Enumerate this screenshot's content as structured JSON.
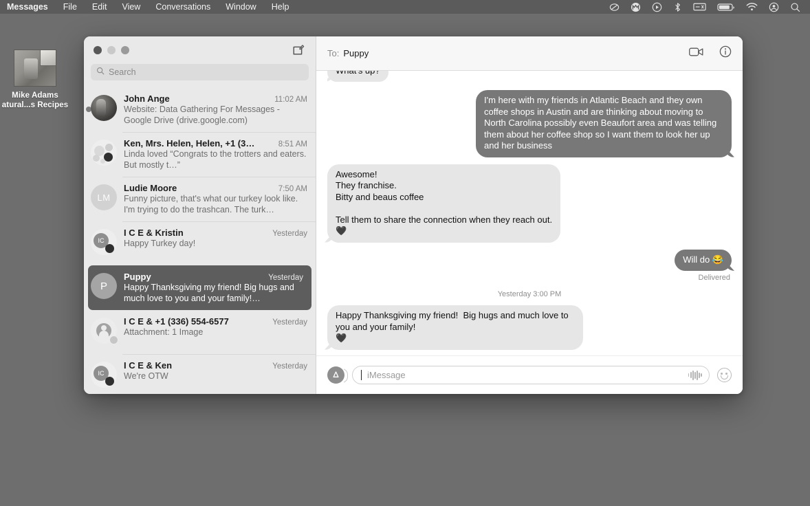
{
  "menubar": {
    "items": [
      {
        "label": "Messages",
        "bold": true
      },
      {
        "label": "File",
        "bold": false
      },
      {
        "label": "Edit",
        "bold": false
      },
      {
        "label": "View",
        "bold": false
      },
      {
        "label": "Conversations",
        "bold": false
      },
      {
        "label": "Window",
        "bold": false
      },
      {
        "label": "Help",
        "bold": false
      }
    ],
    "status_icons": [
      "do-not-disturb-icon",
      "malwarebytes-icon",
      "play-circle-icon",
      "bluetooth-icon",
      "display-icon",
      "battery-icon",
      "wifi-icon",
      "account-icon",
      "spotlight-search-icon"
    ]
  },
  "desktop": {
    "icon_label_line1": "Mike Adams",
    "icon_label_line2": "atural...s Recipes"
  },
  "window": {
    "traffic_lights": [
      "close",
      "minimize",
      "maximize"
    ],
    "compose_label": "compose-new-message"
  },
  "search": {
    "placeholder": "Search"
  },
  "conversations": [
    {
      "name": "John Ange",
      "time": "11:02 AM",
      "preview": "Website: Data Gathering For Messages - Google Drive (drive.google.com)",
      "avatar_type": "photo",
      "avatar_text": "",
      "unread": true,
      "selected": false
    },
    {
      "name": "Ken, Mrs. Helen, Helen, +1 (3…",
      "time": "8:51 AM",
      "preview": "Linda loved “Congrats to the trotters and eaters.  But mostly t…”",
      "avatar_type": "group",
      "avatar_text": "",
      "unread": false,
      "selected": false
    },
    {
      "name": "Ludie Moore",
      "time": "7:50 AM",
      "preview": "Funny picture, that's what our turkey look like. I'm trying to do the trashcan. The turk…",
      "avatar_type": "initials",
      "avatar_text": "LM",
      "unread": false,
      "selected": false
    },
    {
      "name": "I C E & Kristin",
      "time": "Yesterday",
      "preview": "Happy Turkey day!",
      "avatar_type": "initials-dark",
      "avatar_text": "IC",
      "unread": false,
      "selected": false
    },
    {
      "name": "Puppy",
      "time": "Yesterday",
      "preview": "Happy Thanksgiving my friend!  Big hugs and much love to you and your family!…",
      "avatar_type": "selected",
      "avatar_text": "P",
      "unread": false,
      "selected": true
    },
    {
      "name": "I C E & +1 (336) 554-6577",
      "time": "Yesterday",
      "preview": "Attachment: 1 Image",
      "avatar_type": "person",
      "avatar_text": "",
      "unread": false,
      "selected": false
    },
    {
      "name": "I C E & Ken",
      "time": "Yesterday",
      "preview": "We're OTW",
      "avatar_type": "initials-dark",
      "avatar_text": "IC",
      "unread": false,
      "selected": false
    }
  ],
  "thread": {
    "to_label": "To:",
    "recipient": "Puppy",
    "actions": [
      "facetime-video-icon",
      "details-info-icon"
    ],
    "messages": [
      {
        "direction": "in",
        "text": "What's up?",
        "clipped": true
      },
      {
        "direction": "out",
        "text": "I'm here with my friends in Atlantic Beach and they own coffee shops in Austin and are thinking about moving to North Carolina possibly even Beaufort area and was telling them about her coffee shop so I want them to look her up and her business"
      },
      {
        "direction": "in",
        "text": "Awesome!\nThey franchise.\nBitty and beaus coffee\n\nTell them to share the connection when they reach out.\n🖤"
      },
      {
        "direction": "out",
        "text": "Will do 😂",
        "status": "Delivered"
      },
      {
        "direction": "divider",
        "text": "Yesterday 3:00 PM"
      },
      {
        "direction": "in",
        "text": "Happy Thanksgiving my friend!  Big hugs and much love to you and your family!\n🖤"
      }
    ],
    "delivered_label": "Delivered"
  },
  "composer": {
    "apps_button": "app-store-apps-icon",
    "placeholder": "iMessage",
    "audio_icon": "audio-waveform-icon",
    "emoji_icon": "emoji-picker-icon"
  },
  "colors": {
    "desktop": "#6e6e6e",
    "menubar": "#5b5b5b",
    "sidebar": "#e9e9e9",
    "selected_row": "#5d5d5d",
    "bubble_in": "#e6e6e6",
    "bubble_out": "#787878"
  }
}
